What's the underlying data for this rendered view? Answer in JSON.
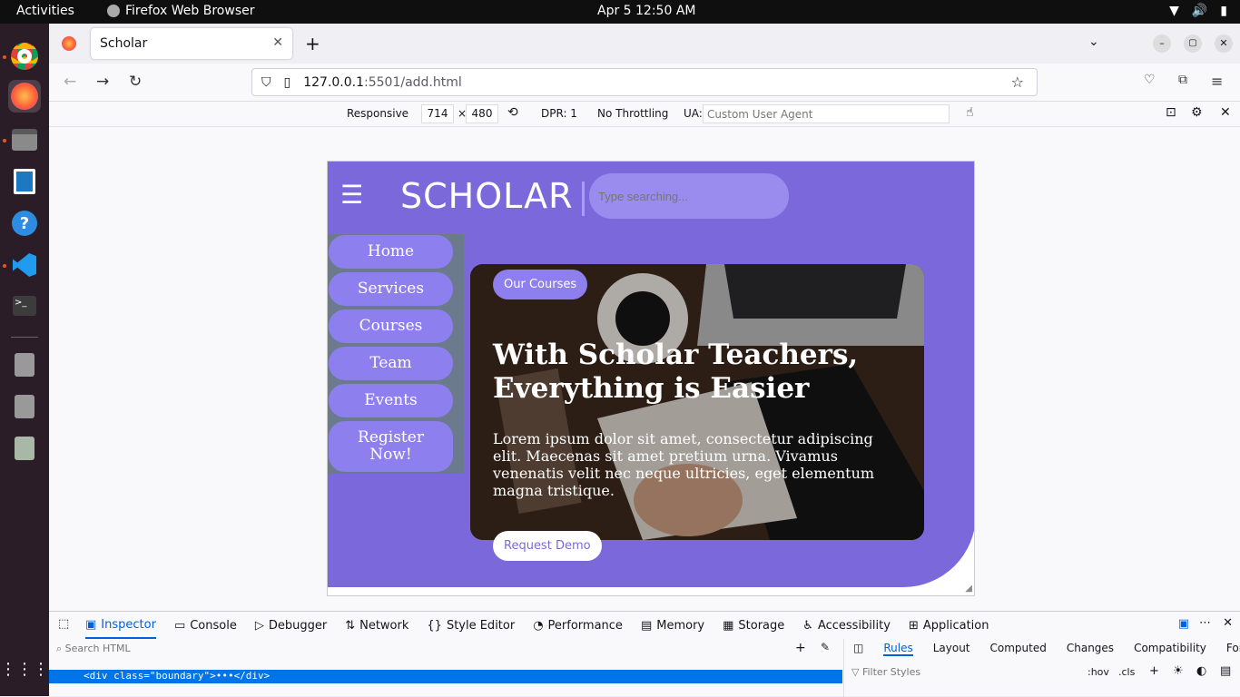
{
  "system": {
    "activities": "Activities",
    "app_name": "Firefox Web Browser",
    "clock": "Apr 5  12:50 AM"
  },
  "browser": {
    "tab_title": "Scholar",
    "url_host": "127.0.0.1",
    "url_rest": ":5501/add.html"
  },
  "responsive": {
    "mode": "Responsive",
    "width": "714",
    "times": "×",
    "height": "480",
    "dpr": "DPR: 1",
    "throttling": "No Throttling",
    "ua_label": "UA:",
    "ua_placeholder": "Custom User Agent"
  },
  "site": {
    "logo": "SCHOLAR",
    "search_placeholder": "Type searching...",
    "menu": [
      "Home",
      "Services",
      "Courses",
      "Team",
      "Events",
      "Register Now!"
    ],
    "tag": "Our Courses",
    "headline": "With Scholar Teachers, Everything is Easier",
    "paragraph": "Lorem ipsum dolor sit amet, consectetur adipiscing elit. Maecenas sit amet pretium urna. Vivamus venenatis velit nec neque ultricies, eget elementum magna tristique.",
    "demo_button": "Request Demo",
    "accent": "#7b69dc"
  },
  "devtools": {
    "tabs": [
      "Inspector",
      "Console",
      "Debugger",
      "Network",
      "Style Editor",
      "Performance",
      "Memory",
      "Storage",
      "Accessibility",
      "Application"
    ],
    "search_html": "Search HTML",
    "selected_node": "<div class=\"boundary\">•••</div>",
    "rules_tabs": [
      "Rules",
      "Layout",
      "Computed",
      "Changes",
      "Compatibility",
      "Fonts"
    ],
    "filter_styles": "Filter Styles",
    "hov": ":hov",
    "cls": ".cls"
  }
}
